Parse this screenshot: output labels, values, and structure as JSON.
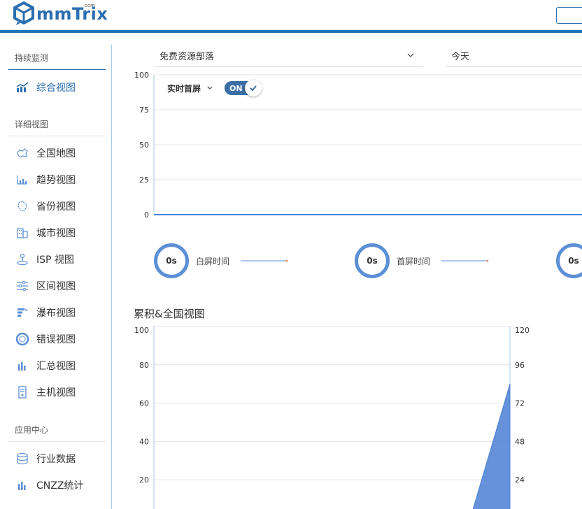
{
  "header": {
    "logo_text": "mmTrix",
    "logo_com": "com"
  },
  "sidebar": {
    "sections": [
      {
        "title": "持续监测"
      },
      {
        "title": "详细视图"
      },
      {
        "title": "应用中心"
      }
    ],
    "items": [
      {
        "label": "综合视图",
        "icon": "trend-chart-icon"
      },
      {
        "label": "全国地图",
        "icon": "china-map-icon"
      },
      {
        "label": "趋势视图",
        "icon": "trend-icon"
      },
      {
        "label": "省份视图",
        "icon": "province-icon"
      },
      {
        "label": "城市视图",
        "icon": "city-building-icon"
      },
      {
        "label": "ISP 视图",
        "icon": "isp-tower-icon"
      },
      {
        "label": "区间视图",
        "icon": "range-slider-icon"
      },
      {
        "label": "瀑布视图",
        "icon": "waterfall-icon"
      },
      {
        "label": "错误视图",
        "icon": "error-ring-icon"
      },
      {
        "label": "汇总视图",
        "icon": "summary-bars-icon"
      },
      {
        "label": "主机视图",
        "icon": "host-server-icon"
      },
      {
        "label": "行业数据",
        "icon": "database-icon"
      },
      {
        "label": "CNZZ统计",
        "icon": "cnzz-bars-icon"
      }
    ]
  },
  "filters": {
    "project": "免费资源部落",
    "date": "今天"
  },
  "realtime": {
    "label": "实时首屏",
    "toggle": "ON"
  },
  "metrics": [
    {
      "value": "0s",
      "label": "白屏时间"
    },
    {
      "value": "0s",
      "label": "首屏时间"
    },
    {
      "value": "0s",
      "label": ""
    }
  ],
  "section2": {
    "title": "累积&全国视图"
  },
  "colors": {
    "accent": "#2a6fb0",
    "ring": "#5b8fd6",
    "series": "#4a7fd4"
  },
  "chart_data": [
    {
      "type": "line",
      "y_ticks": [
        "0",
        "25",
        "50",
        "75",
        "100"
      ],
      "ylim": [
        0,
        100
      ],
      "series": [
        {
          "values": [
            0,
            0,
            0,
            0,
            0,
            0,
            0,
            0,
            0,
            0
          ]
        }
      ]
    },
    {
      "type": "area",
      "y_ticks_left": [
        "20",
        "40",
        "60",
        "80",
        "100"
      ],
      "y_ticks_right": [
        "24",
        "48",
        "72",
        "96",
        "120"
      ],
      "ylim_left": [
        0,
        100
      ],
      "ylim_right": [
        0,
        120
      ],
      "series": [
        {
          "axis": "right",
          "values": [
            0,
            0,
            0,
            0,
            0,
            0,
            0,
            0,
            0,
            84
          ]
        }
      ]
    }
  ]
}
